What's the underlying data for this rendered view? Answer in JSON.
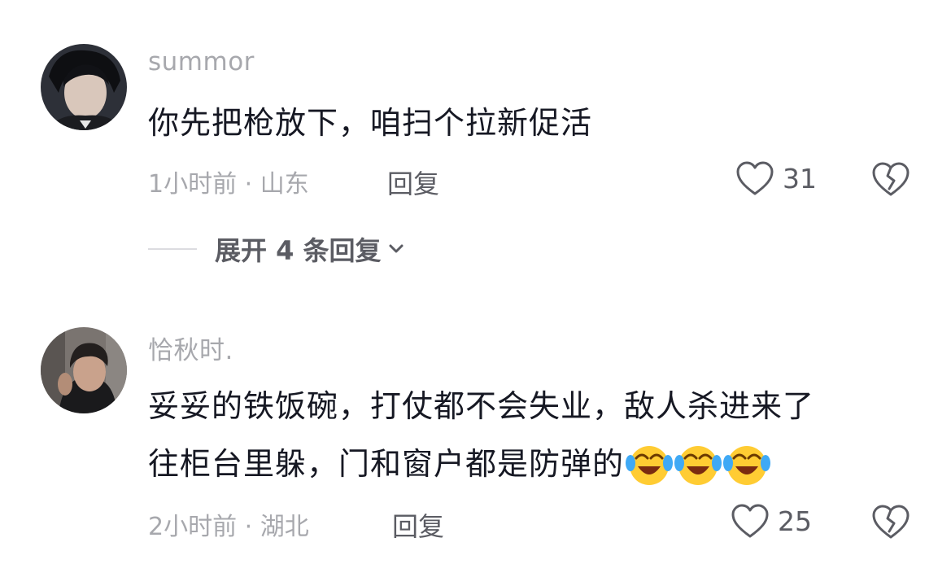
{
  "comments": [
    {
      "username": "summor",
      "text": "你先把枪放下，咱扫个拉新促活",
      "meta": "1小时前 · 山东",
      "reply_label": "回复",
      "likes": "31",
      "expand_label": "展开 4 条回复"
    },
    {
      "username": "恰秋时.",
      "text_line1": "妥妥的铁饭碗，打仗都不会失业，敌人杀进来了",
      "text_line2": "往柜台里躲，门和窗户都是防弹的",
      "emojis": [
        "laughing-crying-emoji",
        "laughing-crying-emoji",
        "laughing-crying-emoji"
      ],
      "meta": "2小时前 · 湖北",
      "reply_label": "回复",
      "likes": "25"
    }
  ],
  "icons": {
    "like": "heart-outline-icon",
    "dislike": "broken-heart-icon",
    "expand": "chevron-down-icon"
  },
  "colors": {
    "text": "#161823",
    "secondary": "#a7a8ad",
    "action": "#5b5c63"
  }
}
